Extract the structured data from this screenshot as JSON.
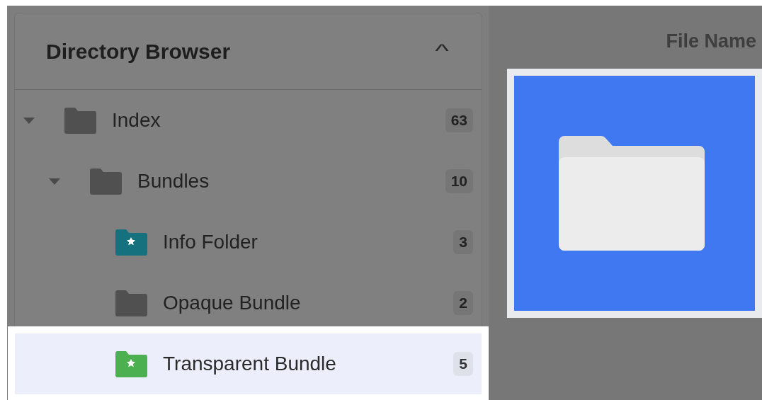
{
  "directory_browser": {
    "title": "Directory Browser",
    "collapse_icon": "^",
    "tree": [
      {
        "label": "Index",
        "count": "63",
        "kind": "folder",
        "expanded": true,
        "selected": false,
        "children": [
          {
            "label": "Bundles",
            "count": "10",
            "kind": "folder",
            "expanded": true,
            "selected": false,
            "children": [
              {
                "label": "Info Folder",
                "count": "3",
                "kind": "star-folder",
                "color": "#16717f",
                "selected": false
              },
              {
                "label": "Opaque Bundle",
                "count": "2",
                "kind": "folder",
                "selected": false
              },
              {
                "label": "Transparent Bundle",
                "count": "5",
                "kind": "star-folder",
                "color": "#4caf50",
                "selected": true
              }
            ]
          }
        ]
      }
    ]
  },
  "file_view": {
    "column_header": "File Name",
    "files": [
      {
        "kind": "folder",
        "selected": true
      }
    ]
  }
}
